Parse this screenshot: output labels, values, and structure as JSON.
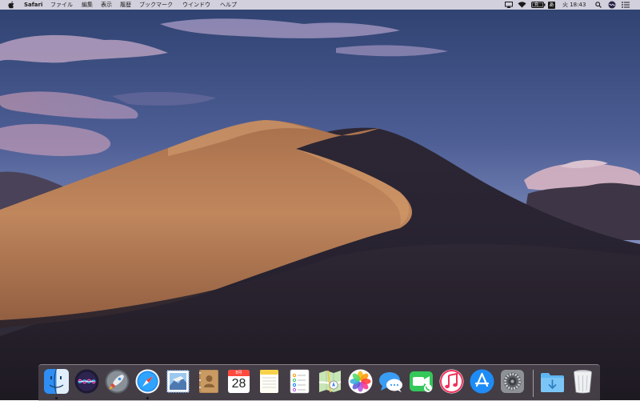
{
  "menubar": {
    "app_name": "Safari",
    "menus": [
      "ファイル",
      "編集",
      "表示",
      "履歴",
      "ブックマーク",
      "ウインドウ",
      "ヘルプ"
    ],
    "battery_label": "充",
    "input_method": "あ",
    "clock": "火 18:43",
    "status_icons": [
      "airplay-icon",
      "wifi-icon",
      "battery-icon",
      "input-method-icon",
      "search-icon",
      "siri-icon",
      "notification-center-icon"
    ]
  },
  "dock": {
    "apps": [
      "Finder",
      "Siri",
      "Launchpad",
      "Safari",
      "メール",
      "連絡先",
      "カレンダー",
      "メモ",
      "リマインダー",
      "マップ",
      "写真",
      "メッセージ",
      "FaceTime",
      "iTunes",
      "App Store",
      "システム環境設定"
    ],
    "right_items": [
      "ダウンロード",
      "ゴミ箱"
    ],
    "calendar": {
      "month": "8月",
      "day": "28"
    },
    "running": [
      "Finder",
      "Safari"
    ]
  },
  "colors": {
    "sky_top": "#33467c",
    "sky_bottom": "#7a88b8",
    "dune_light": "#b9825a",
    "dune_shadow": "#2c2634",
    "menubar_bg": "#ece8ee"
  }
}
